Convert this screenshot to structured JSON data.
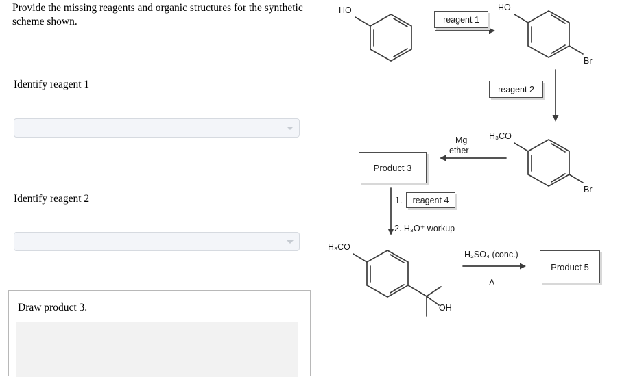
{
  "question": {
    "prompt": "Provide the missing reagents and organic structures for the synthetic scheme shown."
  },
  "form": {
    "fields": [
      {
        "label": "Identify reagent 1",
        "value": "",
        "placeholder": "",
        "chevron_icon": "chevron-down-icon"
      },
      {
        "label": "Identify reagent 2",
        "value": "",
        "placeholder": "",
        "chevron_icon": "chevron-down-icon"
      }
    ],
    "draw_panel": {
      "title": "Draw product 3.",
      "canvas_value": ""
    }
  },
  "scheme": {
    "boxes": {
      "reagent_1": "reagent 1",
      "reagent_2": "reagent 2",
      "product_3": "Product 3",
      "reagent_4": "reagent 4",
      "product_5": "Product 5"
    },
    "arrow_labels": {
      "mg": "Mg",
      "ether": "ether",
      "step_1_prefix": "1.",
      "step_2": "2. H₃O⁺ workup",
      "acid": "H₂SO₄ (conc.)",
      "heat": "Δ"
    },
    "structures": {
      "phenol": {
        "substituents": [
          "HO"
        ]
      },
      "bromophenol": {
        "substituents": [
          "HO",
          "Br"
        ]
      },
      "bromoanisole": {
        "substituents": [
          "H₃CO",
          "Br"
        ]
      },
      "methoxyphenyl_propanol": {
        "substituents": [
          "H₃CO",
          "OH"
        ]
      }
    }
  },
  "colors": {
    "bond": "#3c3c3c",
    "box_border": "#4d4d4d",
    "box_shadow": "#d8d8d8",
    "input_fill": "#f3f5f9",
    "input_border": "#d6dae0",
    "canvas_fill": "#f2f2f2",
    "panel_border": "#b8b8b8"
  }
}
